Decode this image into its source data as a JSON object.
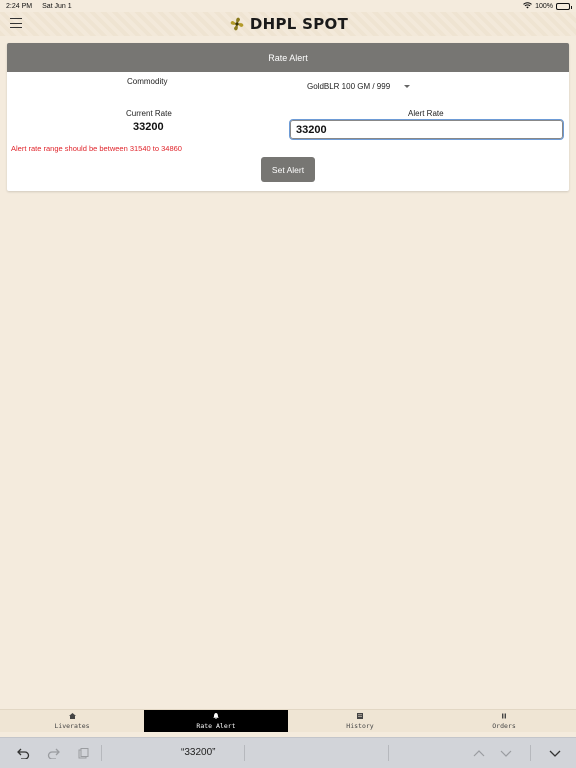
{
  "status_bar": {
    "time": "2:24 PM",
    "date": "Sat Jun 1",
    "battery": "100%"
  },
  "header": {
    "title": "DHPL SPOT"
  },
  "card": {
    "title": "Rate Alert",
    "commodity_label": "Commodity",
    "commodity_value": "GoldBLR 100 GM / 999",
    "current_rate_label": "Current Rate",
    "current_rate_value": "33200",
    "alert_rate_label": "Alert Rate",
    "alert_rate_value": "33200",
    "error_message": "Alert rate range should be between 31540 to 34860",
    "set_alert_label": "Set Alert"
  },
  "bottom_nav": {
    "items": [
      {
        "label": "Liverates",
        "icon": "home-icon"
      },
      {
        "label": "Rate Alert",
        "icon": "bell-icon",
        "active": true
      },
      {
        "label": "History",
        "icon": "history-icon"
      },
      {
        "label": "Orders",
        "icon": "orders-icon"
      }
    ]
  },
  "keyboard_bar": {
    "suggestion": "“33200”"
  },
  "colors": {
    "background": "#f4ebdd",
    "card_header": "#777673",
    "error": "#e0242b",
    "active_nav": "#000000"
  }
}
